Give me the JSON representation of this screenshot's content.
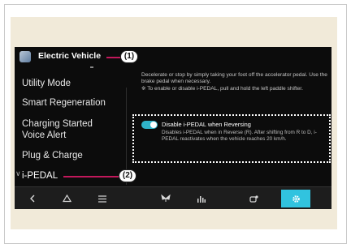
{
  "header": {
    "title": "Electric Vehicle"
  },
  "menu": {
    "items": [
      {
        "label": "Utility Mode"
      },
      {
        "label": "Smart Regeneration"
      },
      {
        "label": "Charging Started Voice Alert"
      },
      {
        "label": "Plug & Charge"
      },
      {
        "label": "i-PEDAL"
      }
    ]
  },
  "content": {
    "description_1": "Decelerate or stop by simply taking your foot off the accelerator pedal. Use the brake pedal when necessary.",
    "description_2": "※ To enable or disable i-PEDAL, pull and hold the left paddle shifter.",
    "option": {
      "label": "Disable i-PEDAL when Reversing",
      "enabled": true,
      "description": "Disables i-PEDAL when in Reverse (R). After shifting from R to D, i-PEDAL reactivates when the vehicle reaches 20 km/h."
    }
  },
  "callouts": {
    "one": "(1)",
    "two": "(2)"
  },
  "bottom_bar": {
    "buttons": [
      {
        "icon": "back-icon"
      },
      {
        "icon": "home-icon"
      },
      {
        "icon": "menu-icon"
      },
      {
        "icon": "fan-icon"
      },
      {
        "icon": "equalizer-icon"
      },
      {
        "icon": "car-settings-icon"
      },
      {
        "icon": "gear-icon",
        "active": true
      }
    ]
  },
  "colors": {
    "accent": "#31c3df",
    "callout_line": "#c2185b",
    "screen_bg": "#0c0c0c",
    "page_bg": "#f1ead9"
  }
}
